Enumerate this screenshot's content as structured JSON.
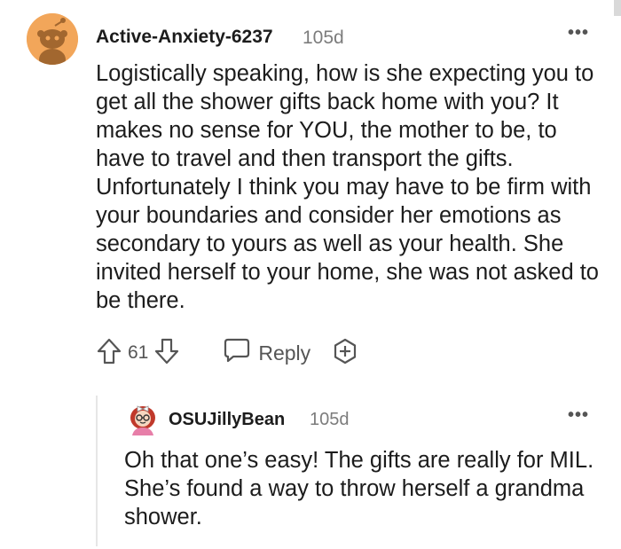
{
  "comments": [
    {
      "author": "Active-Anxiety-6237",
      "age": "105d",
      "more": "•••",
      "body": "Logistically speaking, how is she expecting you to get all the shower gifts back home with you? It makes no sense for YOU, the mother to be, to have to travel and then transport the gifts. Unfortunately I think you may have to be firm with your boundaries and consider her emotions as secondary to yours as well as your health. She invited herself to your home, she was not asked to be there.",
      "score": "61",
      "reply_label": "Reply",
      "avatar_icon": "snoo-avatar-icon"
    },
    {
      "author": "OSUJillyBean",
      "age": "105d",
      "more": "•••",
      "body": "Oh that one’s easy! The gifts are really for MIL. She’s found a way to throw herself a grandma shower.",
      "avatar_icon": "user-avatar-icon"
    }
  ],
  "colors": {
    "avatar_bg": "#f2a65a",
    "meta_gray": "#7c7c7c",
    "icon_gray": "#555555",
    "thread_line": "#e6e6e6"
  }
}
